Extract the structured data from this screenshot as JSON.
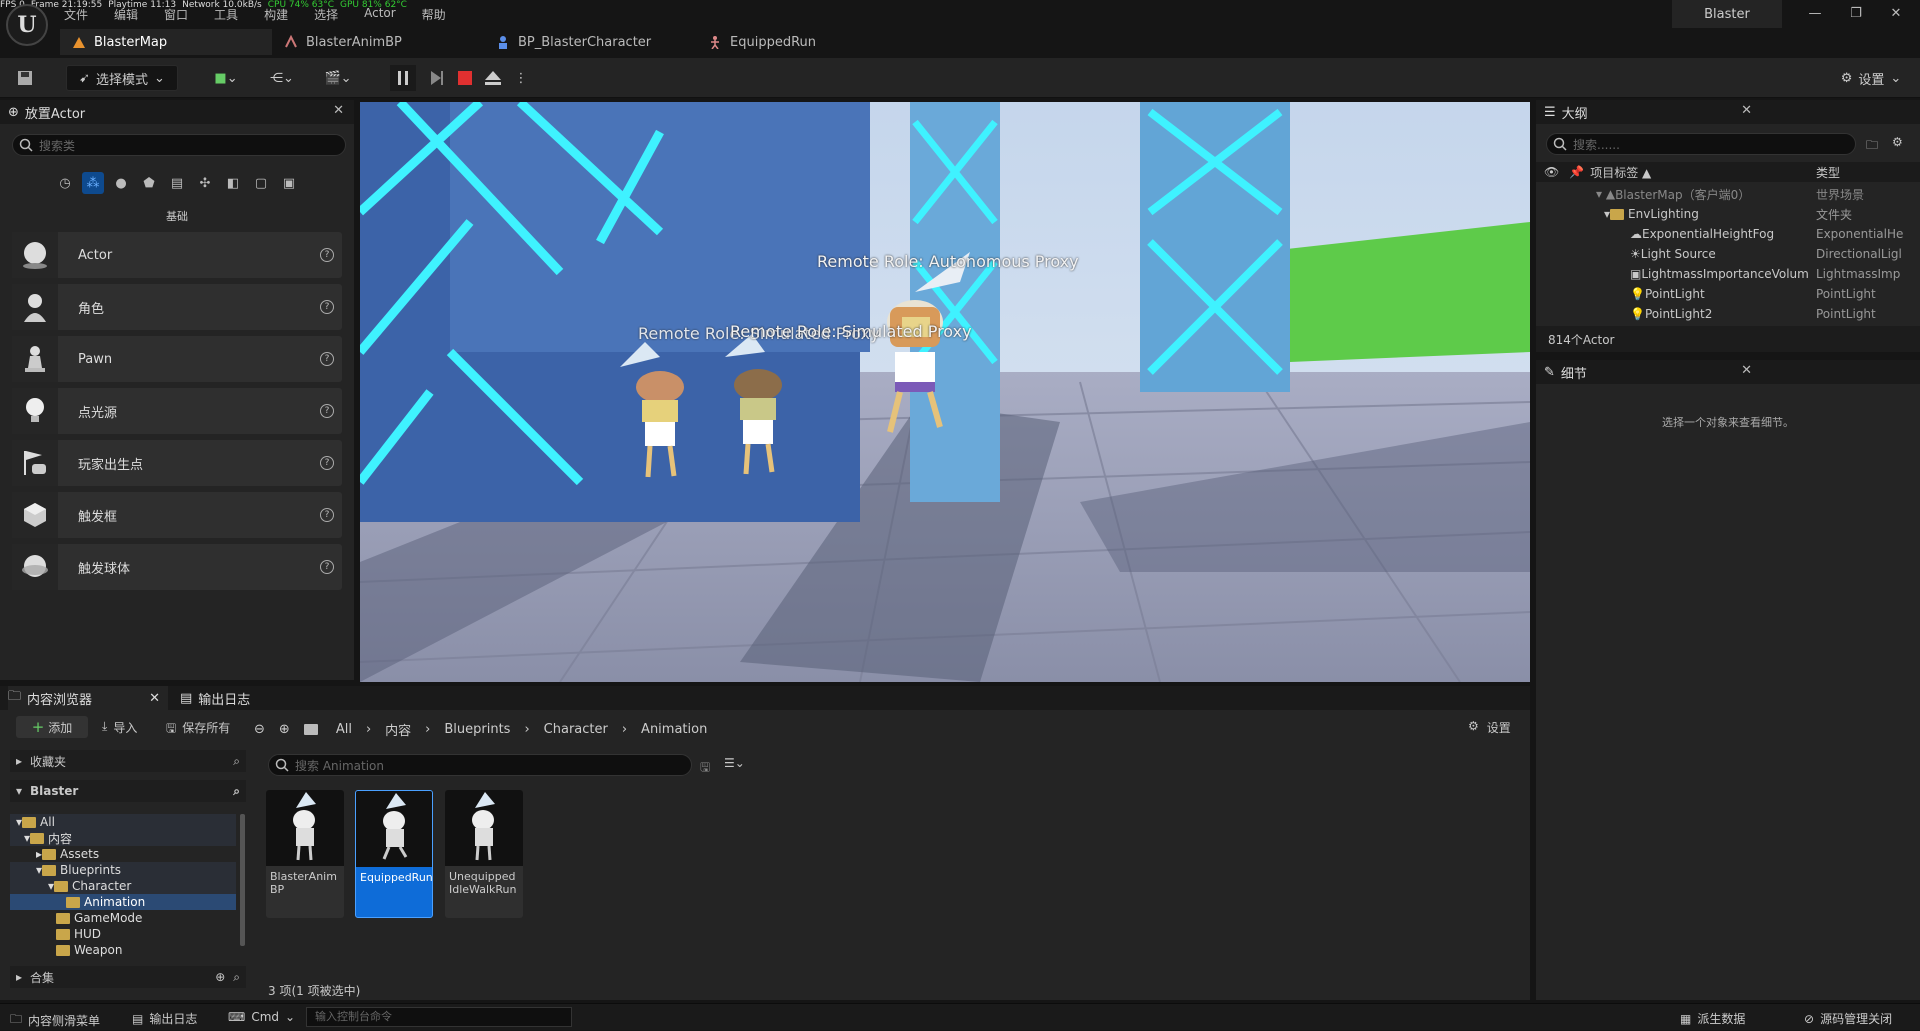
{
  "stats": {
    "fps": "FPS 0",
    "frame": "Frame 21:19:55",
    "playtime": "Playtime 11:13",
    "network": "Network 10.0kB/s",
    "cpu": "CPU 74% 63°C",
    "gpu": "GPU 81% 62°C"
  },
  "menu": [
    "文件",
    "编辑",
    "窗口",
    "工具",
    "构建",
    "选择",
    "Actor",
    "帮助"
  ],
  "window_title": "Blaster",
  "window_controls": {
    "minimize": "—",
    "restore": "❐",
    "close": "✕"
  },
  "tabs": [
    {
      "label": "BlasterMap",
      "icon": "level-icon"
    },
    {
      "label": "BlasterAnimBP",
      "icon": "anim-blueprint-icon"
    },
    {
      "label": "BP_BlasterCharacter",
      "icon": "character-blueprint-icon"
    },
    {
      "label": "EquippedRun",
      "icon": "animation-sequence-icon"
    }
  ],
  "toolbar": {
    "mode_label": "选择模式",
    "settings_label": "设置"
  },
  "place_actors": {
    "title": "放置Actor",
    "search_placeholder": "搜索类",
    "category_label": "基础",
    "items": [
      {
        "label": "Actor",
        "icon": "sphere-icon"
      },
      {
        "label": "角色",
        "icon": "character-icon"
      },
      {
        "label": "Pawn",
        "icon": "pawn-icon"
      },
      {
        "label": "点光源",
        "icon": "light-bulb-icon"
      },
      {
        "label": "玩家出生点",
        "icon": "player-start-icon"
      },
      {
        "label": "触发框",
        "icon": "trigger-box-icon"
      },
      {
        "label": "触发球体",
        "icon": "trigger-sphere-icon"
      }
    ]
  },
  "viewport": {
    "labels": [
      "Remote Role: Autonomous Proxy",
      "Remote Role: Simulated Proxy",
      "Remote Role: Simulated Proxy"
    ]
  },
  "outliner": {
    "title": "大纲",
    "search_placeholder": "搜索......",
    "col_label": "项目标签 ▲",
    "col_type": "类型",
    "rows": [
      {
        "label": "BlasterMap（客户端0）",
        "type": "世界场景"
      },
      {
        "label": "EnvLighting",
        "type": "文件夹"
      },
      {
        "label": "ExponentialHeightFog",
        "type": "ExponentialHe"
      },
      {
        "label": "Light Source",
        "type": "DirectionalLigl"
      },
      {
        "label": "LightmassImportanceVolum",
        "type": "LightmassImp"
      },
      {
        "label": "PointLight",
        "type": "PointLight"
      },
      {
        "label": "PointLight2",
        "type": "PointLight"
      }
    ],
    "count": "814个Actor"
  },
  "details": {
    "title": "细节",
    "empty_text": "选择一个对象来查看细节。"
  },
  "content_browser": {
    "tab_label": "内容浏览器",
    "log_tab_label": "输出日志",
    "add_label": "添加",
    "import_label": "导入",
    "save_all_label": "保存所有",
    "settings_label": "设置",
    "breadcrumbs": [
      "All",
      "内容",
      "Blueprints",
      "Character",
      "Animation"
    ],
    "favorites_label": "收藏夹",
    "project_label": "Blaster",
    "collections_label": "合集",
    "search_placeholder": "搜索 Animation",
    "tree": [
      "All",
      "内容",
      "Assets",
      "Blueprints",
      "Character",
      "Animation",
      "GameMode",
      "HUD",
      "Weapon"
    ],
    "assets": [
      {
        "name": "BlasterAnim BP"
      },
      {
        "name": "EquippedRun"
      },
      {
        "name": "Unequipped IdleWalkRun"
      }
    ],
    "status": "3 项(1 项被选中)"
  },
  "statusbar": {
    "drawer_label": "内容侧滑菜单",
    "log_label": "输出日志",
    "cmd_label": "Cmd",
    "console_placeholder": "输入控制台命令",
    "derived_data_label": "派生数据",
    "source_control_label": "源码管理关闭"
  },
  "colors": {
    "accent": "#0e6cd8",
    "panel": "#242424",
    "stop_red": "#e03030",
    "folder": "#c9a64a"
  }
}
